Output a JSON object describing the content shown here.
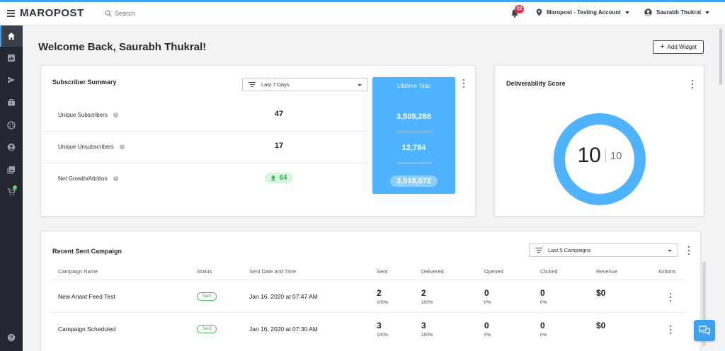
{
  "header": {
    "logo": "MAROPOST",
    "search_placeholder": "Search",
    "notification_count": "22",
    "account": "Maropost - Testing Account",
    "user": "Saurabh Thukral"
  },
  "welcome": "Welcome Back, Saurabh Thukral!",
  "add_widget_label": "Add Widget",
  "subscriber_summary": {
    "title": "Subscriber Summary",
    "filter": "Last 7 Days",
    "rows": [
      {
        "label": "Unique Subscribers",
        "value": "47"
      },
      {
        "label": "Unique Unsubscribers",
        "value": "17"
      },
      {
        "label": "Net Growth/Attrition",
        "value": "64"
      }
    ],
    "lifetime": {
      "title": "Lifetime Total",
      "values": [
        "3,505,288",
        "12,784",
        "3,518,072"
      ]
    }
  },
  "deliverability": {
    "title": "Deliverability Score",
    "score": "10",
    "max": "10",
    "score_fraction": 1.0
  },
  "recent_campaigns": {
    "title": "Recent Sent Campaign",
    "filter": "Last 5 Campaigns",
    "columns": [
      "Campaign Name",
      "Status",
      "Sent Date and Time",
      "Sent",
      "Delivered",
      "Opened",
      "Clicked",
      "Revenue",
      "Actions"
    ],
    "rows": [
      {
        "name": "New Anant Feed Test",
        "status": "Sent",
        "date": "Jan 16, 2020 at 07:47 AM",
        "sent": "2",
        "sent_pct": "100%",
        "delivered": "2",
        "delivered_pct": "100%",
        "opened": "0",
        "opened_pct": "0%",
        "clicked": "0",
        "clicked_pct": "0%",
        "revenue": "$0"
      },
      {
        "name": "Campaign Scheduled",
        "status": "Sent",
        "date": "Jan 16, 2020 at 07:30 AM",
        "sent": "3",
        "sent_pct": "100%",
        "delivered": "3",
        "delivered_pct": "100%",
        "opened": "0",
        "opened_pct": "0%",
        "clicked": "0",
        "clicked_pct": "0%",
        "revenue": "$0"
      }
    ]
  },
  "colors": {
    "accent": "#3ea2f0",
    "lifetime_bg": "#4fb3ff",
    "sidebar_bg": "#23272f",
    "success": "#36b24a",
    "badge": "#e3334b"
  },
  "icons": {
    "sidebar": [
      "home-icon",
      "reports-icon",
      "send-icon",
      "briefcase-icon",
      "palette-icon",
      "contacts-icon",
      "gallery-icon",
      "cart-icon",
      "help-icon"
    ]
  }
}
